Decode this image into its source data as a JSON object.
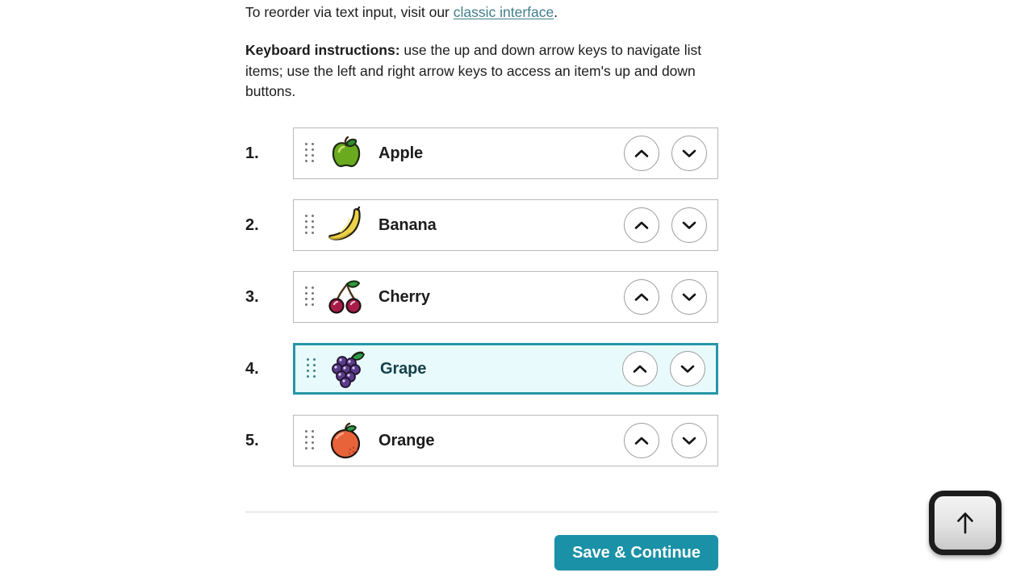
{
  "intro": {
    "text_before": "To reorder via text input, visit our ",
    "link_label": "classic interface",
    "text_after": "."
  },
  "keyboard_instructions": {
    "label": "Keyboard instructions:",
    "text": " use the up and down arrow keys to navigate list items; use the left and right arrow keys to access an item's up and down buttons."
  },
  "list": {
    "items": [
      {
        "number": "1.",
        "label": "Apple",
        "icon": "apple-emoji",
        "selected": false
      },
      {
        "number": "2.",
        "label": "Banana",
        "icon": "banana-emoji",
        "selected": false
      },
      {
        "number": "3.",
        "label": "Cherry",
        "icon": "cherry-emoji",
        "selected": false
      },
      {
        "number": "4.",
        "label": "Grape",
        "icon": "grape-emoji",
        "selected": true
      },
      {
        "number": "5.",
        "label": "Orange",
        "icon": "orange-emoji",
        "selected": false
      }
    ],
    "move_up_icon": "chevron-up-icon",
    "move_down_icon": "chevron-down-icon",
    "drag_handle_icon": "drag-handle-icon"
  },
  "footer": {
    "save_label": "Save & Continue"
  },
  "key_overlay": {
    "icon": "arrow-up-key-icon"
  },
  "colors": {
    "accent": "#1a91a6",
    "selected_border": "#2596a8",
    "selected_fill": "#e9fafc",
    "selected_text": "#14424a",
    "link": "#417e8c",
    "text": "#1c1c1c",
    "row_border": "#b9b9b9"
  }
}
